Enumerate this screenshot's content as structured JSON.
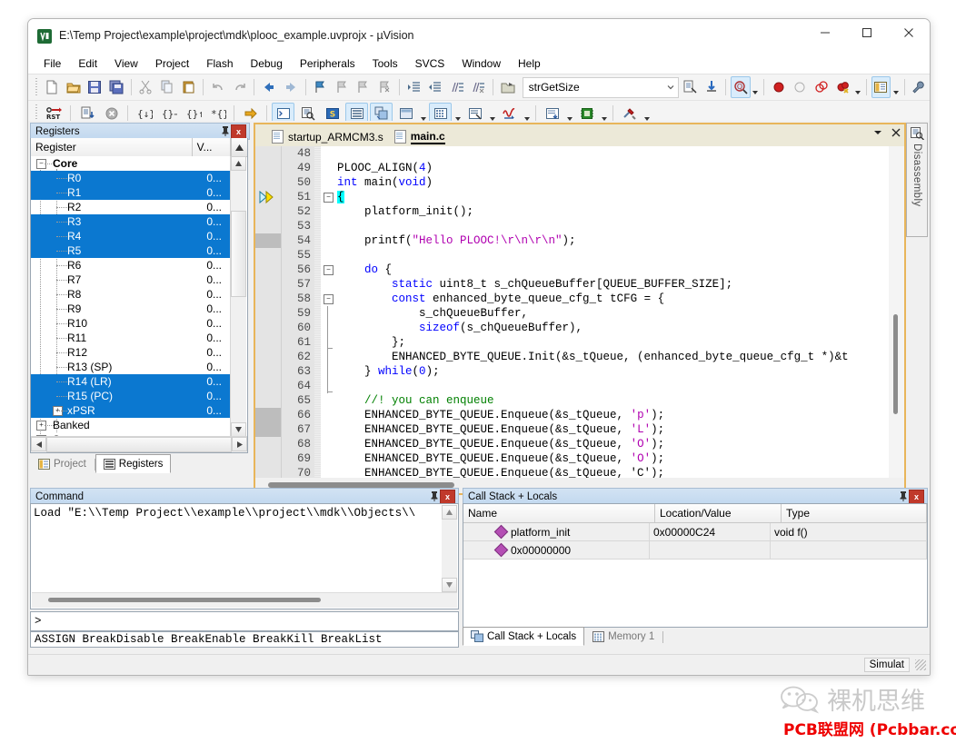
{
  "window": {
    "title": "E:\\Temp Project\\example\\project\\mdk\\plooc_example.uvprojx - µVision",
    "app_icon": "uvision-icon",
    "minimize": "—",
    "maximize": "□",
    "close": "✕"
  },
  "menubar": {
    "items": [
      "File",
      "Edit",
      "View",
      "Project",
      "Flash",
      "Debug",
      "Peripherals",
      "Tools",
      "SVCS",
      "Window",
      "Help"
    ]
  },
  "toolbar": {
    "function_combo": {
      "value": "strGetSize",
      "placeholder": ""
    },
    "row1_icons": [
      "new-file-icon",
      "open-file-icon",
      "save-icon",
      "save-all-icon",
      "cut-icon",
      "copy-icon",
      "paste-icon",
      "undo-icon",
      "redo-icon",
      "navigate-back-icon",
      "navigate-forward-icon",
      "bookmark-toggle-icon",
      "bookmark-prev-icon",
      "bookmark-next-icon",
      "bookmark-clear-icon",
      "indent-icon",
      "outdent-icon",
      "comment-icon",
      "uncomment-icon"
    ],
    "row2_icons": [
      "reset-icon",
      "run-icon",
      "stop-icon",
      "step-icon",
      "step-over-icon",
      "step-out-icon",
      "run-to-cursor-icon",
      "show-next-statement-icon",
      "command-window-icon",
      "disassembly-window-icon",
      "symbols-window-icon",
      "registers-window-icon",
      "call-stack-window-icon",
      "watch-window-icon",
      "memory-window-icon",
      "serial-window-icon",
      "analysis-window-icon",
      "trace-window-icon",
      "system-viewer-icon",
      "toolbox-icon"
    ],
    "debug_icons": [
      "insert-breakpoint-icon",
      "disable-breakpoint-icon",
      "kill-all-breakpoints-icon",
      "disable-all-breakpoints-icon"
    ],
    "misc_icons": [
      "find-in-files-icon",
      "bookmark-list-icon",
      "configure-icon",
      "manage-windows-icon",
      "wrench-icon"
    ]
  },
  "registers_panel": {
    "caption": "Registers",
    "pin_icon": "pin-icon",
    "close_icon": "close-icon",
    "columns": [
      "Register",
      "V..."
    ],
    "rows": [
      {
        "name": "Core",
        "value": "",
        "selected": false,
        "kind": "group",
        "expander": "−"
      },
      {
        "name": "R0",
        "value": "0...",
        "selected": true,
        "kind": "reg"
      },
      {
        "name": "R1",
        "value": "0...",
        "selected": true,
        "kind": "reg"
      },
      {
        "name": "R2",
        "value": "0...",
        "selected": false,
        "kind": "reg"
      },
      {
        "name": "R3",
        "value": "0...",
        "selected": true,
        "kind": "reg"
      },
      {
        "name": "R4",
        "value": "0...",
        "selected": true,
        "kind": "reg"
      },
      {
        "name": "R5",
        "value": "0...",
        "selected": true,
        "kind": "reg"
      },
      {
        "name": "R6",
        "value": "0...",
        "selected": false,
        "kind": "reg"
      },
      {
        "name": "R7",
        "value": "0...",
        "selected": false,
        "kind": "reg"
      },
      {
        "name": "R8",
        "value": "0...",
        "selected": false,
        "kind": "reg"
      },
      {
        "name": "R9",
        "value": "0...",
        "selected": false,
        "kind": "reg"
      },
      {
        "name": "R10",
        "value": "0...",
        "selected": false,
        "kind": "reg"
      },
      {
        "name": "R11",
        "value": "0...",
        "selected": false,
        "kind": "reg"
      },
      {
        "name": "R12",
        "value": "0...",
        "selected": false,
        "kind": "reg"
      },
      {
        "name": "R13 (SP)",
        "value": "0...",
        "selected": false,
        "kind": "reg"
      },
      {
        "name": "R14 (LR)",
        "value": "0...",
        "selected": true,
        "kind": "reg"
      },
      {
        "name": "R15 (PC)",
        "value": "0...",
        "selected": true,
        "kind": "reg"
      },
      {
        "name": "xPSR",
        "value": "0...",
        "selected": true,
        "kind": "reg-exp",
        "expander": "+"
      },
      {
        "name": "Banked",
        "value": "",
        "selected": false,
        "kind": "group2",
        "expander": "+"
      },
      {
        "name": "System",
        "value": "",
        "selected": false,
        "kind": "group2",
        "expander": "+"
      }
    ],
    "tabs": [
      {
        "label": "Project",
        "icon": "project-icon",
        "active": false
      },
      {
        "label": "Registers",
        "icon": "registers-icon",
        "active": true
      }
    ]
  },
  "editor": {
    "tabs": [
      {
        "label": "startup_ARMCM3.s",
        "icon": "source-file-icon",
        "active": false
      },
      {
        "label": "main.c",
        "icon": "source-file-icon",
        "active": true
      }
    ],
    "tab_menu_icon": "chevron-down-icon",
    "tab_close_icon": "close-icon",
    "first_line": 48,
    "lines": [
      {
        "n": 48,
        "fold": "",
        "tokens": []
      },
      {
        "n": 49,
        "fold": "",
        "tokens": [
          {
            "t": "PLOOC_ALIGN(",
            "c": "plain"
          },
          {
            "t": "4",
            "c": "num"
          },
          {
            "t": ")",
            "c": "plain"
          }
        ]
      },
      {
        "n": 50,
        "fold": "",
        "tokens": [
          {
            "t": "int",
            "c": "kw"
          },
          {
            "t": " main(",
            "c": "plain"
          },
          {
            "t": "void",
            "c": "kw"
          },
          {
            "t": ")",
            "c": "plain"
          }
        ]
      },
      {
        "n": 51,
        "fold": "−",
        "marker": "pc-arrow",
        "tokens": [
          {
            "t": "{",
            "c": "hl"
          }
        ]
      },
      {
        "n": 52,
        "fold": "",
        "tokens": [
          {
            "t": "    platform_init();",
            "c": "plain"
          }
        ]
      },
      {
        "n": 53,
        "fold": "",
        "tokens": []
      },
      {
        "n": 54,
        "fold": "",
        "marker": "bookmark",
        "tokens": [
          {
            "t": "    printf(",
            "c": "plain"
          },
          {
            "t": "\"Hello PLOOC!\\r\\n\\r\\n\"",
            "c": "str"
          },
          {
            "t": ");",
            "c": "plain"
          }
        ]
      },
      {
        "n": 55,
        "fold": "",
        "tokens": []
      },
      {
        "n": 56,
        "fold": "−",
        "tokens": [
          {
            "t": "    ",
            "c": "plain"
          },
          {
            "t": "do",
            "c": "kw"
          },
          {
            "t": " {",
            "c": "plain"
          }
        ]
      },
      {
        "n": 57,
        "fold": "",
        "tokens": [
          {
            "t": "        ",
            "c": "plain"
          },
          {
            "t": "static",
            "c": "kw"
          },
          {
            "t": " uint8_t s_chQueueBuffer[QUEUE_BUFFER_SIZE];",
            "c": "plain"
          }
        ]
      },
      {
        "n": 58,
        "fold": "−",
        "tokens": [
          {
            "t": "        ",
            "c": "plain"
          },
          {
            "t": "const",
            "c": "kw"
          },
          {
            "t": " enhanced_byte_queue_cfg_t tCFG = {",
            "c": "plain"
          }
        ]
      },
      {
        "n": 59,
        "fold": "|",
        "tokens": [
          {
            "t": "            s_chQueueBuffer,",
            "c": "plain"
          }
        ]
      },
      {
        "n": 60,
        "fold": "|",
        "tokens": [
          {
            "t": "            ",
            "c": "plain"
          },
          {
            "t": "sizeof",
            "c": "kw"
          },
          {
            "t": "(s_chQueueBuffer),",
            "c": "plain"
          }
        ]
      },
      {
        "n": 61,
        "fold": "└",
        "tokens": [
          {
            "t": "        };",
            "c": "plain"
          }
        ]
      },
      {
        "n": 62,
        "fold": "|",
        "tokens": [
          {
            "t": "        ENHANCED_BYTE_QUEUE.Init(&s_tQueue, (enhanced_byte_queue_cfg_t *)&t",
            "c": "plain"
          }
        ]
      },
      {
        "n": 63,
        "fold": "|",
        "tokens": [
          {
            "t": "    } ",
            "c": "plain"
          },
          {
            "t": "while",
            "c": "kw"
          },
          {
            "t": "(",
            "c": "plain"
          },
          {
            "t": "0",
            "c": "num"
          },
          {
            "t": ");",
            "c": "plain"
          }
        ]
      },
      {
        "n": 64,
        "fold": "└",
        "tokens": []
      },
      {
        "n": 65,
        "fold": "",
        "tokens": [
          {
            "t": "    ",
            "c": "plain"
          },
          {
            "t": "//! you can enqueue",
            "c": "cmt"
          }
        ]
      },
      {
        "n": 66,
        "fold": "",
        "marker": "bookmark",
        "tokens": [
          {
            "t": "    ENHANCED_BYTE_QUEUE.Enqueue(&s_tQueue, ",
            "c": "plain"
          },
          {
            "t": "'p'",
            "c": "str"
          },
          {
            "t": ");",
            "c": "plain"
          }
        ]
      },
      {
        "n": 67,
        "fold": "",
        "marker": "bookmark",
        "tokens": [
          {
            "t": "    ENHANCED_BYTE_QUEUE.Enqueue(&s_tQueue, ",
            "c": "plain"
          },
          {
            "t": "'L'",
            "c": "str"
          },
          {
            "t": ");",
            "c": "plain"
          }
        ]
      },
      {
        "n": 68,
        "fold": "",
        "tokens": [
          {
            "t": "    ENHANCED_BYTE_QUEUE.Enqueue(&s_tQueue, ",
            "c": "plain"
          },
          {
            "t": "'O'",
            "c": "str"
          },
          {
            "t": ");",
            "c": "plain"
          }
        ]
      },
      {
        "n": 69,
        "fold": "",
        "tokens": [
          {
            "t": "    ENHANCED_BYTE_QUEUE.Enqueue(&s_tQueue, ",
            "c": "plain"
          },
          {
            "t": "'O'",
            "c": "str"
          },
          {
            "t": ");",
            "c": "plain"
          }
        ]
      },
      {
        "n": 70,
        "fold": "",
        "tokens": [
          {
            "t": "    ENHANCED_BYTE_QUEUE.Enqueue(&s_tQueue, 'C');",
            "c": "plain"
          }
        ]
      }
    ]
  },
  "disassembly_tab": {
    "label": "Disassembly",
    "icon": "disassembly-icon"
  },
  "command_panel": {
    "caption": "Command",
    "pin_icon": "pin-icon",
    "close_icon": "close-icon",
    "output": "Load \"E:\\\\Temp Project\\\\example\\\\project\\\\mdk\\\\Objects\\\\",
    "prompt": ">",
    "input_value": "",
    "hint": "ASSIGN BreakDisable BreakEnable BreakKill BreakList"
  },
  "callstack_panel": {
    "caption": "Call Stack + Locals",
    "pin_icon": "pin-icon",
    "close_icon": "close-icon",
    "columns": [
      "Name",
      "Location/Value",
      "Type"
    ],
    "rows": [
      {
        "name": "platform_init",
        "location": "0x00000C24",
        "type": "void f()"
      },
      {
        "name": "0x00000000",
        "location": "",
        "type": ""
      }
    ],
    "tabs": [
      {
        "label": "Call Stack + Locals",
        "icon": "call-stack-icon",
        "active": true
      },
      {
        "label": "Memory 1",
        "icon": "memory-icon",
        "active": false
      }
    ]
  },
  "statusbar": {
    "text": "Simulat",
    "grip": "resize-grip-icon"
  },
  "watermarks": {
    "wechat_logo": "wechat-icon",
    "wechat_text": "裸机思维",
    "pcb_text": "PCB联盟网 (Pcbbar.com)"
  },
  "colors": {
    "accent_selection": "#0b78d0",
    "editor_tab_active": "#ffd27f",
    "editor_frame": "#e8b55a",
    "panel_caption": "#c2d8ef",
    "keyword": "#0000ff",
    "string": "#b000b0",
    "comment": "#008000",
    "highlight": "#00ffff",
    "close_btn": "#c0392b",
    "watermark_red": "#ee0000"
  }
}
